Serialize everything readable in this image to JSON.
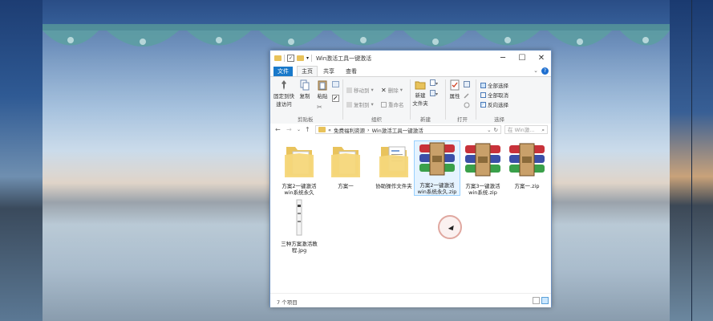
{
  "window": {
    "title": "Win激活工具一键激活",
    "controls": {
      "minimize": "─",
      "maximize": "☐",
      "close": "✕"
    }
  },
  "ribbon_tabs": [
    "文件",
    "主页",
    "共享",
    "查看"
  ],
  "ribbon": {
    "pin_label_1": "固定到快",
    "pin_label_2": "速访问",
    "copy": "复制",
    "paste": "粘贴",
    "clipboard_group": "剪贴板",
    "move_to": "移动到",
    "copy_to": "复制到",
    "delete": "删除",
    "rename": "重命名",
    "organize_group": "组织",
    "new_folder_1": "新建",
    "new_folder_2": "文件夹",
    "new_group": "新建",
    "properties": "属性",
    "open_group": "打开",
    "select_all": "全部选择",
    "select_none": "全部取消",
    "invert_selection": "反向选择",
    "select_group": "选择"
  },
  "address": {
    "path_prefix": "«",
    "crumb_1": "免费福利资源",
    "crumb_sep": "›",
    "crumb_2": "Win激活工具一键激活",
    "search_placeholder": "在 Win激..."
  },
  "files": [
    {
      "name": "方案2一键激活win系统永久",
      "kind": "folder",
      "icon": "folder-icon"
    },
    {
      "name": "方案一",
      "kind": "folder",
      "icon": "folder-icon"
    },
    {
      "name": "协助操作文件夹",
      "kind": "folder",
      "icon": "folder-doc-icon"
    },
    {
      "name": "方案2一键激活win系统永久.zip",
      "kind": "zip",
      "icon": "winrar-icon",
      "selected": true
    },
    {
      "name": "方案3一键激活win系统.zip",
      "kind": "zip",
      "icon": "winrar-icon"
    },
    {
      "name": "方案一.zip",
      "kind": "zip",
      "icon": "winrar-icon"
    },
    {
      "name": "三种方案激活教程.jpg",
      "kind": "image",
      "icon": "image-file-icon"
    }
  ],
  "file_labels": {
    "f0a": "方案2一键激活",
    "f0b": "win系统永久",
    "f1a": "方案一",
    "f2a": "协助操作文件夹",
    "f3a": "方案2一键激活",
    "f3b": "win系统永久.zip",
    "f4a": "方案3一键激活",
    "f4b": "win系统.zip",
    "f5a": "方案一.zip",
    "f6a": "三种方案激活教",
    "f6b": "程.jpg"
  },
  "status": {
    "item_count": "7 个项目"
  },
  "colors": {
    "accent": "#1979ca",
    "selection": "#cde8ff",
    "folder": "#e8c25a"
  }
}
